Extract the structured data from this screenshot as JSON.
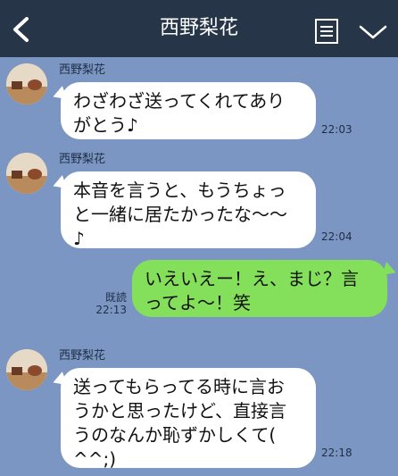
{
  "header": {
    "title": "西野梨花",
    "back_icon": "chevron-left-icon",
    "menu_icon": "document-list-icon",
    "expand_icon": "chevron-down-icon"
  },
  "colors": {
    "header_bg": "#263548",
    "chat_bg": "#7b96c2",
    "incoming_bubble": "#ffffff",
    "outgoing_bubble": "#84e05a"
  },
  "messages": [
    {
      "direction": "incoming",
      "sender": "西野梨花",
      "lines": [
        "わざわざ送ってくれてあり",
        "がとう♪"
      ],
      "time": "22:03"
    },
    {
      "direction": "incoming",
      "sender": "西野梨花",
      "lines": [
        "本音を言うと、もうちょっ",
        "と一緒に居たかったな〜〜",
        "♪"
      ],
      "time": "22:04"
    },
    {
      "direction": "outgoing",
      "lines": [
        "いえいえー！え、まじ？言",
        "ってよ〜！笑"
      ],
      "read_label": "既読",
      "time": "22:13"
    },
    {
      "direction": "incoming",
      "sender": "西野梨花",
      "lines": [
        "送ってもらってる時に言お",
        "うかと思ったけど、直接言",
        "うのなんか恥ずかしくて(",
        "^^;)"
      ],
      "time": "22:18"
    }
  ]
}
